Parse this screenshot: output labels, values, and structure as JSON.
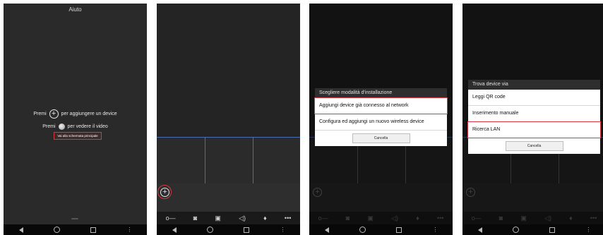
{
  "phone1": {
    "title": "Aiuto",
    "line1_prefix": "Premi",
    "line1_suffix": "per aggiungere un device",
    "line2_prefix": "Premi",
    "line2_suffix": "per vedere il video",
    "main_link": "Vai alla schermata principale"
  },
  "phone3": {
    "dialog_title": "Scegliere modalità d'installazione",
    "option1": "Aggiungi device già connesso al network",
    "option2": "Configura ed aggiungi un nuovo wireless device",
    "cancel": "Cancella"
  },
  "phone4": {
    "dialog_title": "Trova device via",
    "option1": "Leggi QR code",
    "option2": "Inserimento manuale",
    "option3": "Ricerca LAN",
    "cancel": "Cancella"
  },
  "colors": {
    "highlight": "#d9363e",
    "divider": "#4a6fb0",
    "background": "#232323"
  },
  "icons": {
    "toolbar": [
      "key-icon",
      "camera-icon",
      "video-record-icon",
      "speaker-icon",
      "microphone-icon",
      "more-icon"
    ],
    "nav": [
      "back-icon",
      "home-icon",
      "recents-icon",
      "menu-icon"
    ]
  }
}
